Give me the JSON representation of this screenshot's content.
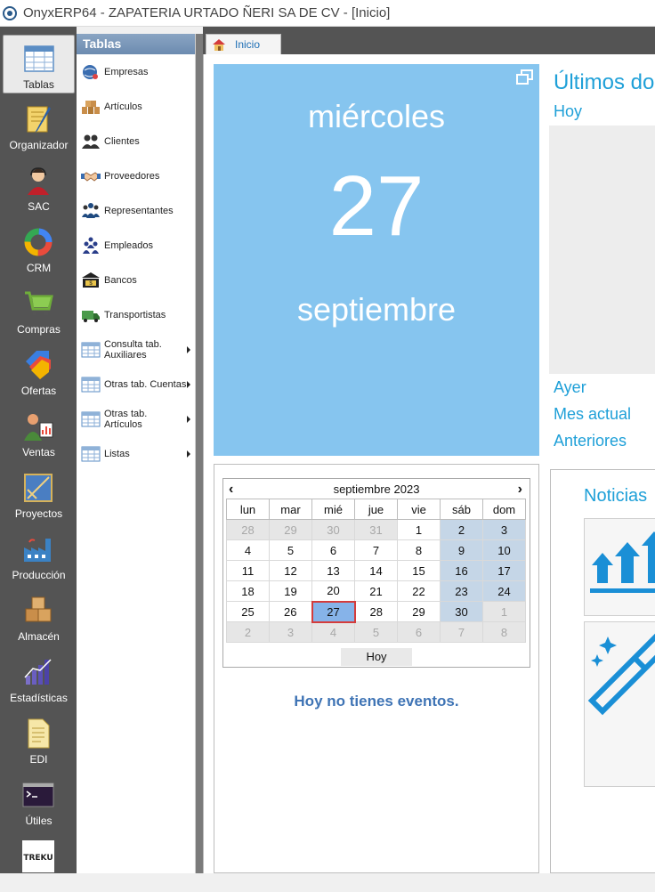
{
  "window": {
    "title": "OnyxERP64 - ZAPATERIA URTADO ÑERI SA DE CV - [Inicio]"
  },
  "modules": [
    {
      "label": "Tablas",
      "icon": "table-icon",
      "active": true
    },
    {
      "label": "Organizador",
      "icon": "notepad-pen-icon"
    },
    {
      "label": "SAC",
      "icon": "support-agent-icon"
    },
    {
      "label": "CRM",
      "icon": "crm-ring-icon"
    },
    {
      "label": "Compras",
      "icon": "shopping-cart-icon"
    },
    {
      "label": "Ofertas",
      "icon": "price-tags-icon"
    },
    {
      "label": "Ventas",
      "icon": "salesperson-chart-icon"
    },
    {
      "label": "Proyectos",
      "icon": "blueprint-icon"
    },
    {
      "label": "Producción",
      "icon": "factory-icon"
    },
    {
      "label": "Almacén",
      "icon": "boxes-icon"
    },
    {
      "label": "Estadísticas",
      "icon": "bar-chart-icon"
    },
    {
      "label": "EDI",
      "icon": "document-icon"
    },
    {
      "label": "Útiles",
      "icon": "terminal-icon"
    },
    {
      "label": "TREKU",
      "icon": "treku-logo-icon"
    }
  ],
  "submenu": {
    "header": "Tablas",
    "items": [
      {
        "label": "Empresas",
        "icon": "globe-icon",
        "arrow": false
      },
      {
        "label": "Artículos",
        "icon": "boxes-icon",
        "arrow": false
      },
      {
        "label": "Clientes",
        "icon": "people-icon",
        "arrow": false
      },
      {
        "label": "Proveedores",
        "icon": "handshake-icon",
        "arrow": false
      },
      {
        "label": "Representantes",
        "icon": "group-icon",
        "arrow": false
      },
      {
        "label": "Empleados",
        "icon": "team-icon",
        "arrow": false
      },
      {
        "label": "Bancos",
        "icon": "bank-icon",
        "arrow": false
      },
      {
        "label": "Transportistas",
        "icon": "truck-icon",
        "arrow": false
      },
      {
        "label": "Consulta tab. Auxiliares",
        "icon": "grid-icon",
        "arrow": true
      },
      {
        "label": "Otras tab. Cuentas",
        "icon": "grid-icon",
        "arrow": true
      },
      {
        "label": "Otras tab. Artículos",
        "icon": "grid-icon",
        "arrow": true
      },
      {
        "label": "Listas",
        "icon": "grid-icon",
        "arrow": true
      }
    ]
  },
  "tabs": [
    {
      "label": "Inicio",
      "icon": "home-icon"
    }
  ],
  "date_tile": {
    "weekday": "miércoles",
    "day": "27",
    "month": "septiembre"
  },
  "ultimos": {
    "title": "Últimos do",
    "links": [
      "Hoy",
      "Ayer",
      "Mes actual",
      "Anteriores"
    ]
  },
  "calendar": {
    "month_label": "septiembre 2023",
    "day_headers": [
      "lun",
      "mar",
      "mié",
      "jue",
      "vie",
      "sáb",
      "dom"
    ],
    "weeks": [
      [
        "28",
        "29",
        "30",
        "31",
        "1",
        "2",
        "3"
      ],
      [
        "4",
        "5",
        "6",
        "7",
        "8",
        "9",
        "10"
      ],
      [
        "11",
        "12",
        "13",
        "14",
        "15",
        "16",
        "17"
      ],
      [
        "18",
        "19",
        "20",
        "21",
        "22",
        "23",
        "24"
      ],
      [
        "25",
        "26",
        "27",
        "28",
        "29",
        "30",
        "1"
      ],
      [
        "2",
        "3",
        "4",
        "5",
        "6",
        "7",
        "8"
      ]
    ],
    "today_label": "Hoy",
    "selected_day": "27"
  },
  "events": {
    "empty_text": "Hoy no tienes eventos."
  },
  "news": {
    "title": "Noticias"
  },
  "colors": {
    "accent": "#1fa0d8",
    "date_tile": "#86c5ef",
    "sidebar": "#545454"
  }
}
